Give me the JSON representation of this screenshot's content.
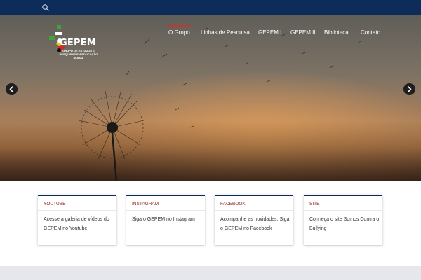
{
  "header": {
    "search_icon": "search-icon"
  },
  "logo": {
    "name": "GEPEM",
    "subtitle": "GRUPO DE ESTUDOS E PESQUISAS EM EDUCAÇÃO MORAL"
  },
  "nav": {
    "items": [
      {
        "label": "O Grupo",
        "active": true
      },
      {
        "label": "Linhas de Pesquisa",
        "active": false
      },
      {
        "label": "GEPEM I",
        "active": false
      },
      {
        "label": "GEPEM II",
        "active": false
      },
      {
        "label": "Biblioteca",
        "active": false
      },
      {
        "label": "Contato",
        "active": false
      }
    ]
  },
  "slider": {
    "prev_icon": "chevron-left-icon",
    "next_icon": "chevron-right-icon"
  },
  "cards": [
    {
      "title": "YOUTUBE",
      "text": "Acesse a galeria de vídeos do GEPEM no Youtube"
    },
    {
      "title": "INSTAGRAM",
      "text": "Siga o GEPEM no Instagram"
    },
    {
      "title": "FACEBOOK",
      "text": "Acompanhe as novidades. Siga o GEPEM no Facebook"
    },
    {
      "title": "SITE",
      "text": "Conheça o site Somos Contra o Bullying"
    }
  ],
  "colors": {
    "topbar": "#0d2c5a",
    "card_title": "#8b1d1d",
    "active_nav_underline": "#c0392b"
  }
}
